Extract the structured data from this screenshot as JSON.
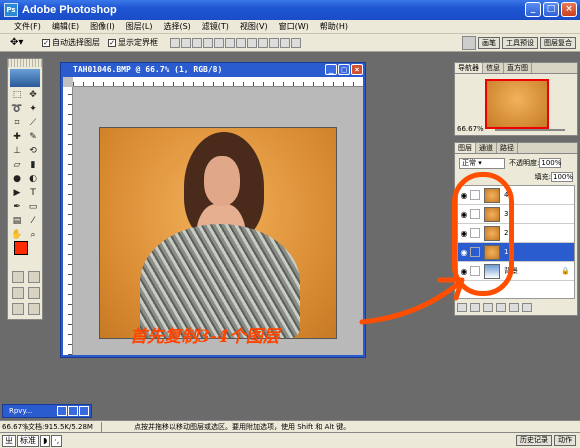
{
  "app": {
    "title": "Adobe Photoshop",
    "icon": "ps-app-icon"
  },
  "window_buttons": {
    "minimize": "_",
    "maximize": "□",
    "close": "×"
  },
  "menu": [
    "文件(F)",
    "编辑(E)",
    "图像(I)",
    "图层(L)",
    "选择(S)",
    "滤镜(T)",
    "视图(V)",
    "窗口(W)",
    "帮助(H)"
  ],
  "options": {
    "auto_select": "自动选择图层",
    "show_bounds": "显示定界框",
    "right_tabs": [
      "画笔",
      "工具预设",
      "图层复合"
    ]
  },
  "document": {
    "title": "TAH01046.BMP @ 66.7% (1, RGB/8)",
    "annotation": "首先复制3-4个图层",
    "annotation_color": "#ff4500"
  },
  "navigator": {
    "tabs": [
      "导航器",
      "信息",
      "直方图"
    ],
    "zoom": "66.67%"
  },
  "layers_panel": {
    "tabs": [
      "图层",
      "通道",
      "路径"
    ],
    "blend_mode": "正常",
    "opacity_label": "不透明度:",
    "opacity_value": "100%",
    "fill_label": "填充:",
    "fill_value": "100%",
    "layers": [
      {
        "name": "4",
        "selected": false
      },
      {
        "name": "3",
        "selected": false
      },
      {
        "name": "2",
        "selected": false
      },
      {
        "name": "1",
        "selected": true
      },
      {
        "name": "背景",
        "selected": false
      }
    ]
  },
  "minimized_doc": {
    "title": "Rpvy..."
  },
  "status": {
    "zoom": "66.67%",
    "doc_size": "文档:915.5K/5.28M",
    "hint": "点按并拖移以移动图层或选区。要用附加选项，使用 Shift 和 Alt 键。"
  },
  "taskbar": {
    "ime": [
      "标准"
    ],
    "tabs": [
      "历史记录",
      "动作"
    ]
  }
}
